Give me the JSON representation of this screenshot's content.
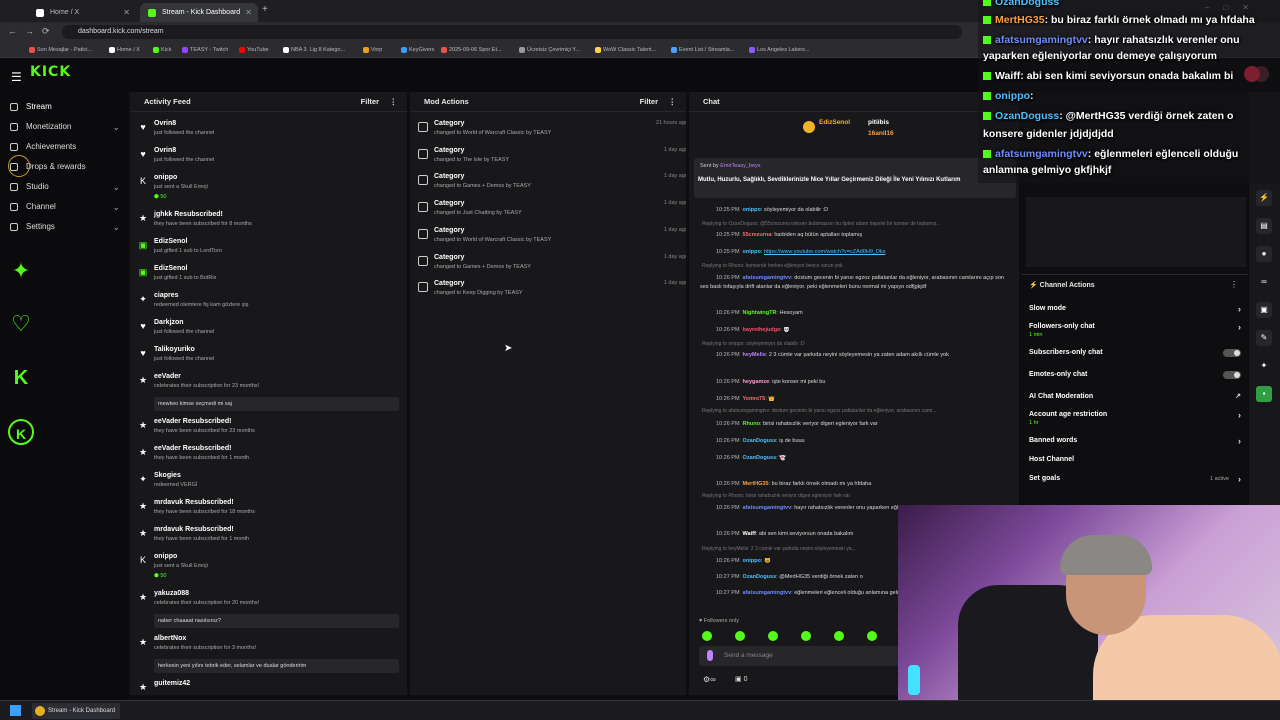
{
  "browser": {
    "tabs": [
      "Home / X",
      "Stream - Kick Dashboard"
    ],
    "url": "dashboard.kick.com/stream",
    "bookmarks": [
      "Son Mesajlar - Patici...",
      "Home / X",
      "Kick",
      "TEASY - Twitch",
      "YouTube",
      "NBA 3. Lig 8 Katego...",
      "Vorp",
      "KeyGivers",
      "2025-09-06 Spor Et...",
      "Ücretsiz Çevrimiçi Y...",
      "WoW Classic Talent...",
      "Event List / Streamla...",
      "Los Angeles Lakers..."
    ]
  },
  "logo": "KICK",
  "sidebar": {
    "items": [
      {
        "label": "Stream"
      },
      {
        "label": "Monetization"
      },
      {
        "label": "Achievements"
      },
      {
        "label": "Drops & rewards"
      },
      {
        "label": "Studio"
      },
      {
        "label": "Channel"
      },
      {
        "label": "Settings"
      }
    ]
  },
  "activity": {
    "title": "Activity Feed",
    "filter": "Filter",
    "items": [
      {
        "name": "Ovrin8",
        "sub": "just followed the channel",
        "time": "11 minutes ago",
        "icon": "♥"
      },
      {
        "name": "Ovrin8",
        "sub": "just followed the channel",
        "time": "11 minutes ago",
        "icon": "♥"
      },
      {
        "name": "onippo",
        "sub": "just sent a Skull Emoji",
        "time": "17 minutes ago",
        "icon": "K",
        "kicks": "50"
      },
      {
        "name": "jghkk Resubscribed!",
        "sub": "they have been subscribed for 8 months",
        "time": "5 hours ago",
        "icon": "★"
      },
      {
        "name": "EdizSenol",
        "sub": "just gifted 1 sub to LordToro",
        "time": "5 hours ago",
        "icon": "▣"
      },
      {
        "name": "EdizSenol",
        "sub": "just gifted 1 sub to BotRix",
        "time": "5 hours ago",
        "icon": "▣"
      },
      {
        "name": "ciapres",
        "sub": "redeemed olemtere fiş kam gözlere şiş",
        "time": "6 hours ago",
        "icon": "✦"
      },
      {
        "name": "Darkjzon",
        "sub": "just followed the channel",
        "time": "7 hours ago",
        "icon": "♥"
      },
      {
        "name": "Talikoyuriko",
        "sub": "just followed the channel",
        "time": "7 hours ago",
        "icon": "♥"
      },
      {
        "name": "eeVader",
        "sub": "celebrates their subscription for 23 months!",
        "time": "21 hours ago",
        "icon": "★",
        "msg": "mewtwo kimse seçmedi mi saj"
      },
      {
        "name": "eeVader Resubscribed!",
        "sub": "they have been subscribed for 23 months",
        "time": "21 hours ago",
        "icon": "★"
      },
      {
        "name": "eeVader Resubscribed!",
        "sub": "they have been subscribed for 1 month",
        "time": "21 hours ago",
        "icon": "★"
      },
      {
        "name": "Skogies",
        "sub": "redeemed VERGİ",
        "time": "22 hours ago",
        "icon": "✦"
      },
      {
        "name": "mrdavuk Resubscribed!",
        "sub": "they have been subscribed for 18 months",
        "time": "22 hours ago",
        "icon": "★"
      },
      {
        "name": "mrdavuk Resubscribed!",
        "sub": "they have been subscribed for 1 month",
        "time": "22 hours ago",
        "icon": "★"
      },
      {
        "name": "onippo",
        "sub": "just sent a Skull Emoji",
        "time": "23 hours ago",
        "icon": "K",
        "kicks": "50"
      },
      {
        "name": "yakuza088",
        "sub": "celebrates their subscription for 20 months!",
        "time": "23 hours ago",
        "icon": "★",
        "msg": "naber chaaaat nasılsınız?"
      },
      {
        "name": "albertNox",
        "sub": "celebrates their subscription for 3 months!",
        "time": "23 hours ago",
        "icon": "★",
        "msg": "herkesin yeni yılını tebrik eder, selamlar ve dualar gönderirim"
      },
      {
        "name": "guitemiz42",
        "sub": "",
        "time": "23 hours ago",
        "icon": "★"
      }
    ]
  },
  "modactions": {
    "title": "Mod Actions",
    "filter": "Filter",
    "items": [
      {
        "name": "Category",
        "sub": "changed to World of Warcraft Classic by TEASY",
        "time": "21 hours ago"
      },
      {
        "name": "Category",
        "sub": "changed to The Isle by TEASY",
        "time": "1 day ago"
      },
      {
        "name": "Category",
        "sub": "changed to Games + Demos by TEASY",
        "time": "1 day ago"
      },
      {
        "name": "Category",
        "sub": "changed to Just Chatting by TEASY",
        "time": "1 day ago"
      },
      {
        "name": "Category",
        "sub": "changed to World of Warcraft Classic by TEASY",
        "time": "1 day ago"
      },
      {
        "name": "Category",
        "sub": "changed to Games + Demos by TEASY",
        "time": "1 day ago"
      },
      {
        "name": "Category",
        "sub": "changed to Keep Digging by TEASY",
        "time": "1 day ago"
      }
    ]
  },
  "chat": {
    "title": "Chat",
    "top_users": [
      "EdizSenol",
      "pitiibis",
      "16anil16"
    ],
    "pinned_by": "Sent by",
    "pinned_user": "EmirTeasy_beys",
    "pinned_text": "Mutlu, Huzurlu, Sağlıklı, Sevdiklerinizle Nice Yıllar Geçirmeniz Dileği İle Yeni Yılınızı Kutlarım",
    "lines": [
      {
        "type": "msg",
        "time": "10:25 PM",
        "user": "onippo",
        "color": "#4ec0ff",
        "text": "söyleyemiyor da olabilir :D"
      },
      {
        "type": "rep",
        "text": "Replying to OzanDoguss: @55cmzurna istesen bulamazsın bu tipleri adam hepsini bir konser de toplamış..."
      },
      {
        "type": "msg",
        "time": "10:25 PM",
        "user": "55cmzurna",
        "color": "#ff6b6b",
        "text": "harbiden aq bütün aptalları toplamış"
      },
      {
        "type": "msg",
        "time": "10:25 PM",
        "user": "onippo",
        "color": "#4ec0ff",
        "text": "https://www.youtube.com/watch?v=cZAd0H9_Dks"
      },
      {
        "type": "rep",
        "text": "Replying to Rhuno: konserde herkes eğleniyor bence sorun yok"
      },
      {
        "type": "msg",
        "time": "10:26 PM",
        "user": "afatsumgamingtvv",
        "color": "#6f8cff",
        "text": "dostum gecenin bi yarısı egzoz patlatanlar da eğleniyor, arabasının camlarını açıp son ses baslı tofaşıyla drift atanlar da eğleniyor. peki eğlenmeleri bunu normal mi yapıyo odfjgkjdf"
      },
      {
        "type": "msg",
        "time": "10:26 PM",
        "user": "NightwingTR",
        "color": "#53fc18",
        "text": "Hesoyam"
      },
      {
        "type": "msg",
        "time": "10:26 PM",
        "user": "bayrethejudge",
        "color": "#ff4d6d",
        "text": "💀"
      },
      {
        "type": "rep",
        "text": "Replying to onippo: söyleyemiyor da olabilir :D"
      },
      {
        "type": "msg",
        "time": "10:26 PM",
        "user": "heyMelis",
        "color": "#c084fc",
        "text": "2 3 cümle var şarkıda neyini söyleyemesin ya zaten adam akıllı cümle yok"
      },
      {
        "type": "msg",
        "time": "10:26 PM",
        "user": "heygamze",
        "color": "#ff9ad5",
        "text": "işte konser mi peki bu"
      },
      {
        "type": "msg",
        "time": "10:26 PM",
        "user": "Yemre75",
        "color": "#ff6b6b",
        "text": "👑"
      },
      {
        "type": "rep",
        "text": "Replying to afatsumgamingtvv: dostum gecenin bi yarısı egzoz patlatanlar da eğleniyor, arabasının cami..."
      },
      {
        "type": "msg",
        "time": "10:26 PM",
        "user": "Rhuno",
        "color": "#53fc18",
        "text": "birisi rahatsızlık veriyor digeri egleniyor fark var"
      },
      {
        "type": "msg",
        "time": "10:26 PM",
        "user": "OzanDoguss",
        "color": "#4ec0ff",
        "text": "iş de buuu"
      },
      {
        "type": "msg",
        "time": "10:26 PM",
        "user": "OzanDoguss",
        "color": "#4ec0ff",
        "text": "👻"
      },
      {
        "type": "msg",
        "time": "10:26 PM",
        "user": "MertHG35",
        "color": "#ff9f43",
        "text": "bu biraz farklı örnek olmadı mı ya hfdaha"
      },
      {
        "type": "rep",
        "text": "Replying to Rhuno: birisi rahatsızlık veriyor digeri egleniyor fark var"
      },
      {
        "type": "msg",
        "time": "10:26 PM",
        "user": "afatsumgamingtvv",
        "color": "#6f8cff",
        "text": "hayır rahatsızlık verenler onu yaparken eğleniyorlar onu demeye çalışıyorum"
      },
      {
        "type": "msg",
        "time": "10:26 PM",
        "user": "Waiff",
        "color": "#fff",
        "text": "abi sen kimi seviyorsun onada bakalım"
      },
      {
        "type": "rep",
        "text": "Replying to heyMelis: 2 3 cümle var şarkıda neyini söyleyemesin ya..."
      },
      {
        "type": "msg",
        "time": "10:26 PM",
        "user": "onippo",
        "color": "#4ec0ff",
        "text": "🐱"
      },
      {
        "type": "msg",
        "time": "10:27 PM",
        "user": "OzanDoguss",
        "color": "#4ec0ff",
        "text": "@MertHG35 verdiği örnek zaten o"
      },
      {
        "type": "msg",
        "time": "10:27 PM",
        "user": "afatsumgamingtvv",
        "color": "#6f8cff",
        "text": "eğlenmeleri eğlenceli olduğu anlamına gelmiyo gkfjhkjf"
      }
    ],
    "followers_only": "Followers only",
    "placeholder": "Send a message",
    "count": "0"
  },
  "overlay": [
    {
      "user": "OzanDoguss",
      "color": "#4ec0ff",
      "text": ""
    },
    {
      "user": "MertHG35",
      "color": "#ff9f43",
      "text": ": bu biraz farklı örnek olmadı mı ya hfdaha"
    },
    {
      "user": "afatsumgamingtvv",
      "color": "#6f8cff",
      "text": ": hayır rahatsızlık verenler onu"
    },
    {
      "user": "",
      "color": "#fff",
      "text": "yaparken eğleniyorlar onu demeye çalışıyorum"
    },
    {
      "user": "Waiff",
      "color": "#fff",
      "text": ": abi sen kimi seviyorsun onada bakalım bi"
    },
    {
      "user": "onippo",
      "color": "#4ec0ff",
      "text": ":"
    },
    {
      "user": "OzanDoguss",
      "color": "#4ec0ff",
      "text": ": @MertHG35 verdiği örnek zaten o"
    },
    {
      "user": "",
      "color": "#fff",
      "text": "konsere gidenler jdjdjdjdd"
    },
    {
      "user": "afatsumgamingtvv",
      "color": "#6f8cff",
      "text": ": eğlenmeleri eğlenceli olduğu"
    },
    {
      "user": "",
      "color": "#fff",
      "text": "anlamına gelmiyo gkfjhkjf"
    }
  ],
  "channel_actions": {
    "title": "Channel Actions",
    "items": [
      {
        "label": "Slow mode",
        "kind": "arrow"
      },
      {
        "label": "Followers-only chat",
        "kind": "arrow",
        "sub": "1 min"
      },
      {
        "label": "Subscribers-only chat",
        "kind": "toggle"
      },
      {
        "label": "Emotes-only chat",
        "kind": "toggle"
      },
      {
        "label": "AI Chat Moderation",
        "kind": "ext"
      },
      {
        "label": "Account age restriction",
        "kind": "arrow",
        "sub": "1 hr"
      },
      {
        "label": "Banned words",
        "kind": "arrow"
      },
      {
        "label": "Host Channel",
        "kind": "none"
      },
      {
        "label": "Set goals",
        "kind": "arrow",
        "sub2": "1 active"
      }
    ]
  },
  "taskbar": {
    "app": "Stream - Kick Dashboard"
  },
  "colors": {
    "accent": "#53fc18",
    "bg": "#0e0e10",
    "panel": "#18181b"
  }
}
